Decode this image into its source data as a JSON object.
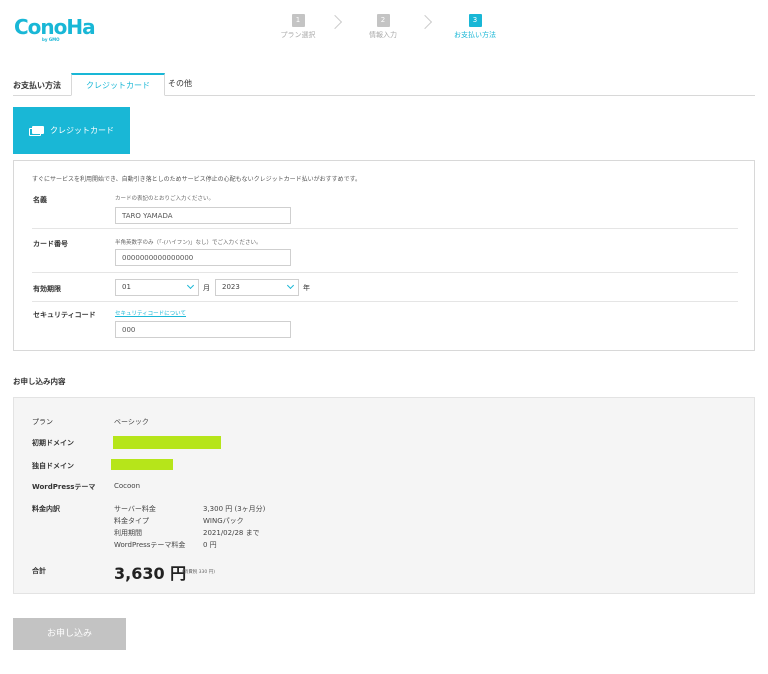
{
  "brand": {
    "logo_text": "ConoHa",
    "logo_sub": "by GMO",
    "accent_color": "#19b7d6",
    "highlight_color": "#b6e51a"
  },
  "steps": [
    {
      "num": "1",
      "label": "プラン選択"
    },
    {
      "num": "2",
      "label": "情報入力"
    },
    {
      "num": "3",
      "label": "お支払い方法",
      "active": true
    }
  ],
  "payment": {
    "heading": "お支払い方法",
    "tabs": [
      {
        "label": "クレジットカード",
        "active": true
      },
      {
        "label": "その他"
      }
    ],
    "card_button": "クレジットカード",
    "intro": "すぐにサービスを利用開始でき、自動引き落としのためサービス停止の心配もないクレジットカード払いがおすすめです。",
    "name": {
      "label": "名義",
      "note": "カードの表記のとおりご入力ください。",
      "value": "TARO YAMADA"
    },
    "number": {
      "label": "カード番号",
      "note": "半角英数字のみ（「-(ハイフン)」なし）でご入力ください。",
      "value": "0000000000000000"
    },
    "expiry": {
      "label": "有効期限",
      "month": "01",
      "month_unit": "月",
      "year": "2023",
      "year_unit": "年"
    },
    "cvc": {
      "label": "セキュリティコード",
      "link": "セキュリティコードについて",
      "value": "000"
    }
  },
  "summary": {
    "title": "お申し込み内容",
    "plan": {
      "label": "プラン",
      "value": "ベーシック"
    },
    "initial_domain": {
      "label": "初期ドメイン"
    },
    "custom_domain": {
      "label": "独自ドメイン"
    },
    "theme": {
      "label": "WordPressテーマ",
      "value": "Cocoon"
    },
    "fees": {
      "label": "料金内訳",
      "items": [
        {
          "k": "サーバー料金",
          "v": "3,300 円 (3ヶ月分)"
        },
        {
          "k": "料金タイプ",
          "v": "WINGパック"
        },
        {
          "k": "利用期間",
          "v": "2021/02/28 まで"
        },
        {
          "k": "WordPressテーマ料金",
          "v": "0 円"
        }
      ]
    },
    "total": {
      "label": "合計",
      "value": "3,630 円",
      "tax": "(消費税 330 円)"
    }
  },
  "submit_label": "お申し込み"
}
